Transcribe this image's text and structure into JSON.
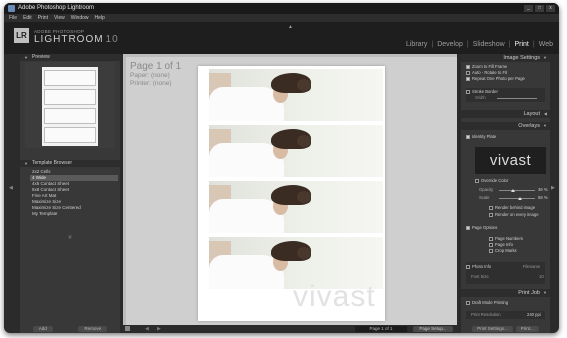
{
  "window": {
    "title": "Adobe Photoshop Lightroom",
    "controls": [
      "_",
      "□",
      "x"
    ]
  },
  "menu": [
    "File",
    "Edit",
    "Print",
    "View",
    "Window",
    "Help"
  ],
  "identity_plate": {
    "badge": "LR",
    "small": "ADOBE PHOTOSHOP",
    "big": "LIGHTROOM",
    "version": "10"
  },
  "modules": [
    "Library",
    "Develop",
    "Slideshow",
    "Print",
    "Web"
  ],
  "active_module": "Print",
  "left": {
    "preview_header": "Preview",
    "templates_header": "Template Browser",
    "templates": [
      "2x2 Cells",
      "4 Wide",
      "4x5 Contact Sheet",
      "5x8 Contact Sheet",
      "Fine Art Mat",
      "Maximize Size",
      "Maximize Size Centered",
      "My Template"
    ],
    "selected_template": "4 Wide",
    "add_label": "Add",
    "remove_label": "Remove"
  },
  "center": {
    "page_title": "Page 1 of 1",
    "paper": "Paper: (none)",
    "printer": "Printer: (none)",
    "watermark": "vivast",
    "page_indicator": "Page 1 of 1",
    "page_setup": "Page Setup..."
  },
  "right": {
    "image_settings": "Image Settings",
    "zoom": "Zoom to Fill Frame",
    "autorotate": "Auto - Rotate to Fit",
    "repeat": "Repeat One Photo per Page",
    "stroke": "Stroke Border",
    "width": "Width",
    "layout": "Layout",
    "overlays": "Overlays",
    "identity_plate": "Identity Plate",
    "identity_text": "vivast",
    "override_color": "Override Color",
    "opacity": "Opacity",
    "opacity_val": "36 %",
    "scale": "Scale",
    "scale_val": "58 %",
    "render_behind": "Render behind image",
    "render_every": "Render on every image",
    "page_options": "Page Options",
    "page_numbers": "Page Numbers",
    "page_info": "Page Info",
    "crop_marks": "Crop Marks",
    "photo_info": "Photo Info",
    "photo_info_val": "Filename",
    "font_size": "Font Size",
    "font_size_val": "10",
    "print_job": "Print Job",
    "draft": "Draft Mode Printing",
    "print_resolution": "Print Resolution",
    "resolution_val": "240 ppi",
    "print_settings_btn": "Print Settings...",
    "print_btn": "Print..."
  },
  "colors": {
    "panel": "#383838",
    "header": "#2d2d2d",
    "canvas": "#cfcfcf"
  }
}
